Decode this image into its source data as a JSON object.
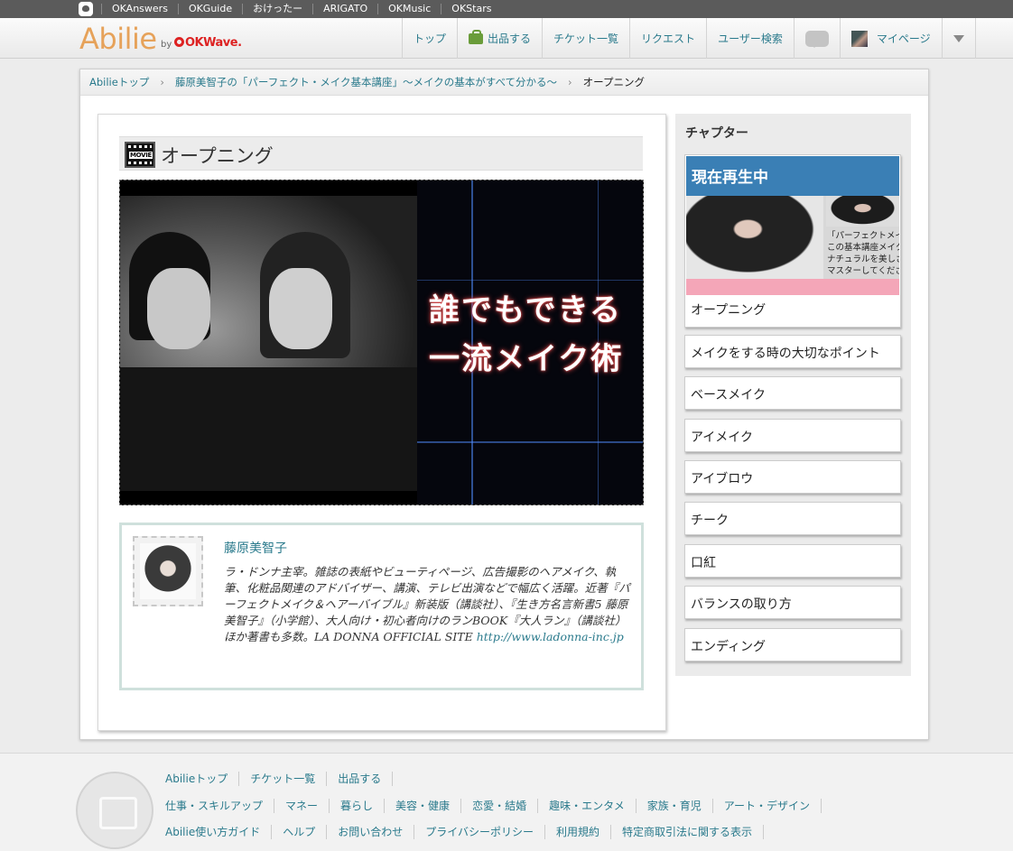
{
  "topbar": {
    "links": [
      "OKAnswers",
      "OKGuide",
      "おけったー",
      "ARIGATO",
      "OKMusic",
      "OKStars"
    ]
  },
  "header": {
    "brand": "Abilie",
    "brand_by": "by",
    "brand_okwave": "OKWave.",
    "nav": {
      "top": "トップ",
      "sell": "出品する",
      "tickets": "チケット一覧",
      "request": "リクエスト",
      "user_search": "ユーザー検索",
      "mypage": "マイページ"
    }
  },
  "breadcrumb": {
    "home": "Abilieトップ",
    "course": "藤原美智子の「パーフェクト・メイク基本講座」～メイクの基本がすべて分かる～",
    "current": "オープニング"
  },
  "video_section": {
    "title": "オープニング",
    "movie_badge": "MOVIE",
    "overlay_line1": "誰でもできる",
    "overlay_line2": "一流メイク術"
  },
  "profile": {
    "name": "藤原美智子",
    "bio": "ラ・ドンナ主宰。雑誌の表紙やビューティページ、広告撮影のヘアメイク、執筆、化粧品関連のアドバイザー、講演、テレビ出演などで幅広く活躍。近著『パーフェクトメイク＆ヘアーバイブル』新装版（講談社）、『生き方名言新書5 藤原美智子』（小学館）、大人向け・初心者向けのランBOOK『大人ラン』（講談社）ほか著書も多数。LA DONNA OFFICIAL SITE ",
    "site_url": "http://www.ladonna-inc.jp"
  },
  "chapters": {
    "heading": "チャプター",
    "now_playing_label": "現在再生中",
    "now_playing_caption": "オープニング",
    "thumb_side_text": [
      "「パーフェクトメイ",
      "この基本講座メイク",
      "ナチュラルを美しさ",
      "マスターしてくださ"
    ],
    "items": [
      "メイクをする時の大切なポイント",
      "ベースメイク",
      "アイメイク",
      "アイブロウ",
      "チーク",
      "口紅",
      "バランスの取り方",
      "エンディング"
    ]
  },
  "footer": {
    "row1": [
      "Abilieトップ",
      "チケット一覧",
      "出品する"
    ],
    "row2": [
      "仕事・スキルアップ",
      "マネー",
      "暮らし",
      "美容・健康",
      "恋愛・結婚",
      "趣味・エンタメ",
      "家族・育児",
      "アート・デザイン"
    ],
    "row3": [
      "Abilie使い方ガイド",
      "ヘルプ",
      "お問い合わせ",
      "プライバシーポリシー",
      "利用規約",
      "特定商取引法に関する表示"
    ]
  }
}
